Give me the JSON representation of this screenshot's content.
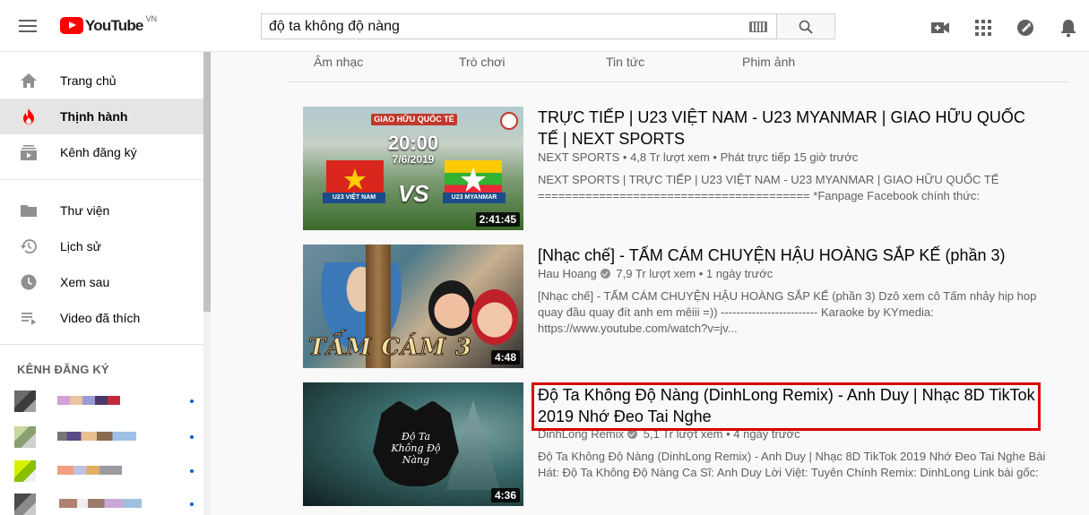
{
  "header": {
    "logo_text": "YouTube",
    "country_code": "VN",
    "search_value": "độ ta không độ nàng",
    "icons": [
      "menu-icon",
      "keyboard-icon",
      "search-icon",
      "create-video-icon",
      "apps-icon",
      "messages-icon",
      "notifications-icon"
    ]
  },
  "sidebar": {
    "items": [
      {
        "label": "Trang chủ",
        "icon": "home-icon"
      },
      {
        "label": "Thịnh hành",
        "icon": "trending-icon"
      },
      {
        "label": "Kênh đăng ký",
        "icon": "subscriptions-icon"
      },
      {
        "label": "Thư viện",
        "icon": "library-icon"
      },
      {
        "label": "Lịch sử",
        "icon": "history-icon"
      },
      {
        "label": "Xem sau",
        "icon": "watch-later-icon"
      },
      {
        "label": "Video đã thích",
        "icon": "liked-videos-icon"
      }
    ],
    "active": "Thịnh hành",
    "section_title": "KÊNH ĐĂNG KÝ"
  },
  "tabs": [
    "Âm nhạc",
    "Trò chơi",
    "Tin tức",
    "Phim ảnh"
  ],
  "results": [
    {
      "title": "TRỰC TIẾP | U23 VIỆT NAM - U23 MYANMAR | GIAO HỮU QUỐC TẾ | NEXT SPORTS",
      "channel": "NEXT SPORTS",
      "meta": "4,8 Tr lượt xem • Phát trực tiếp 15 giờ trước",
      "desc": "NEXT SPORTS | TRỰC TIẾP | U23 VIỆT NAM - U23 MYANMAR | GIAO HỮU QUỐC TẾ ======================================== *Fanpage Facebook chính thức:",
      "duration": "2:41:45",
      "thumb_text": {
        "top": "GIAO HỮU QUỐC TẾ",
        "time": "20:00",
        "date": "7/6/2019",
        "team1": "U23 VIỆT NAM",
        "vs": "VS",
        "team2": "U23 MYANMAR"
      }
    },
    {
      "title": "[Nhạc chế] - TẤM CÁM CHUYỆN HẬU HOÀNG SẮP KẾ (phần 3)",
      "channel": "Hau Hoang",
      "meta": "7,9 Tr lượt xem • 1 ngày trước",
      "desc": "[Nhạc chế] - TẤM CÁM CHUYỆN HẬU HOÀNG SẮP KẾ (phần 3) Dzô xem cô Tấm nhảy hip hop quay đầu quay đít anh em mêiii =)) ------------------------- Karaoke by KYmedia: https://www.youtube.com/watch?v=jv...",
      "duration": "4:48",
      "thumb_text": {
        "caption": "TẤM CÁM 3"
      }
    },
    {
      "title": "Độ Ta Không Độ Nàng (DinhLong Remix) - Anh Duy | Nhạc 8D TikTok 2019 Nhớ Đeo Tai Nghe",
      "channel": "DinhLong Remix",
      "meta": "5,1 Tr lượt xem • 4 ngày trước",
      "desc": "Độ Ta Không Độ Nàng (DinhLong Remix) - Anh Duy | Nhạc 8D TikTok 2019 Nhớ Đeo Tai Nghe Bài Hát: Độ Ta Không Độ Nàng Ca Sĩ: Anh Duy Lời Việt: Tuyên Chính Remix: DinhLong Link bài gốc:",
      "duration": "4:36"
    }
  ],
  "colors": {
    "accent": "#ff0000",
    "highlight_box": "#d80000",
    "sidebar_active": "#e5e5e5"
  }
}
